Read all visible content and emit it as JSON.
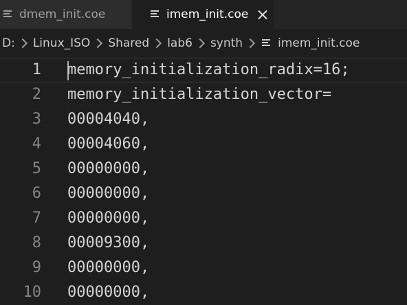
{
  "tabs": [
    {
      "label": "dmem_init.coe",
      "active": false
    },
    {
      "label": "imem_init.coe",
      "active": true
    }
  ],
  "breadcrumb": [
    "D:",
    "Linux_ISO",
    "Shared",
    "lab6",
    "synth",
    "imem_init.coe"
  ],
  "editor": {
    "lines": [
      {
        "number": "1",
        "text": "memory_initialization_radix=16;"
      },
      {
        "number": "2",
        "text": "memory_initialization_vector="
      },
      {
        "number": "3",
        "text": "00004040,"
      },
      {
        "number": "4",
        "text": "00004060,"
      },
      {
        "number": "5",
        "text": "00000000,"
      },
      {
        "number": "6",
        "text": "00000000,"
      },
      {
        "number": "7",
        "text": "00000000,"
      },
      {
        "number": "8",
        "text": "00009300,"
      },
      {
        "number": "9",
        "text": "00000000,"
      },
      {
        "number": "10",
        "text": "00000000,"
      }
    ]
  },
  "colors": {
    "editor_background": "#1e1e1e",
    "tabbar_background": "#252526",
    "inactive_tab": "#2d2d2d",
    "text": "#d4d4d4",
    "line_number": "#858585"
  }
}
